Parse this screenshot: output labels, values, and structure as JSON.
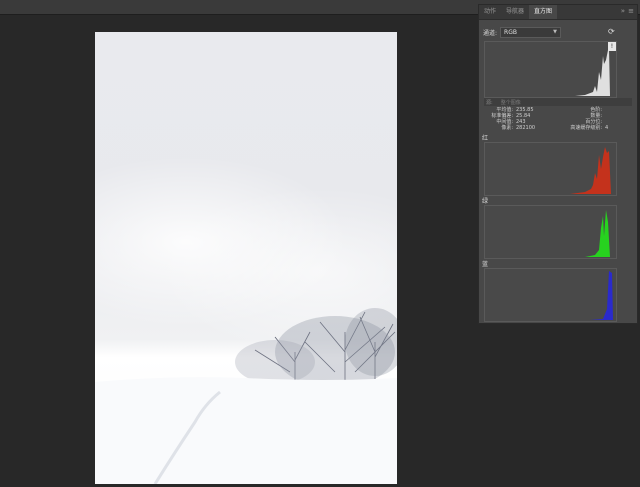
{
  "panel": {
    "tabs": [
      {
        "label": "动作",
        "active": false
      },
      {
        "label": "导航器",
        "active": false
      },
      {
        "label": "直方图",
        "active": true
      }
    ],
    "collapse_glyph": "»",
    "menu_glyph": "≡",
    "channel_label": "通道:",
    "channel_value": "RGB",
    "source_label": "源:",
    "source_value": "整个图像",
    "warning_glyph": "!",
    "stats": {
      "mean_label": "平均值:",
      "mean": "235.85",
      "stddev_label": "标准偏差:",
      "stddev": "25.84",
      "median_label": "中间值:",
      "median": "243",
      "pixels_label": "像素:",
      "pixels": "282100",
      "level_label": "色阶:",
      "level": "",
      "count_label": "数量:",
      "count": "",
      "percentile_label": "百分位:",
      "percentile": "",
      "cache_label": "高速缓存级别:",
      "cache": "4"
    },
    "channels": [
      {
        "label": "红",
        "color": "#c4321c"
      },
      {
        "label": "绿",
        "color": "#27d21f"
      },
      {
        "label": "蓝",
        "color": "#2a2acd"
      }
    ],
    "composite_color": "#e0e0e0"
  },
  "icons": {
    "refresh": "refresh-icon",
    "warning": "warning-icon",
    "dropdown": "chevron-down-icon"
  }
}
